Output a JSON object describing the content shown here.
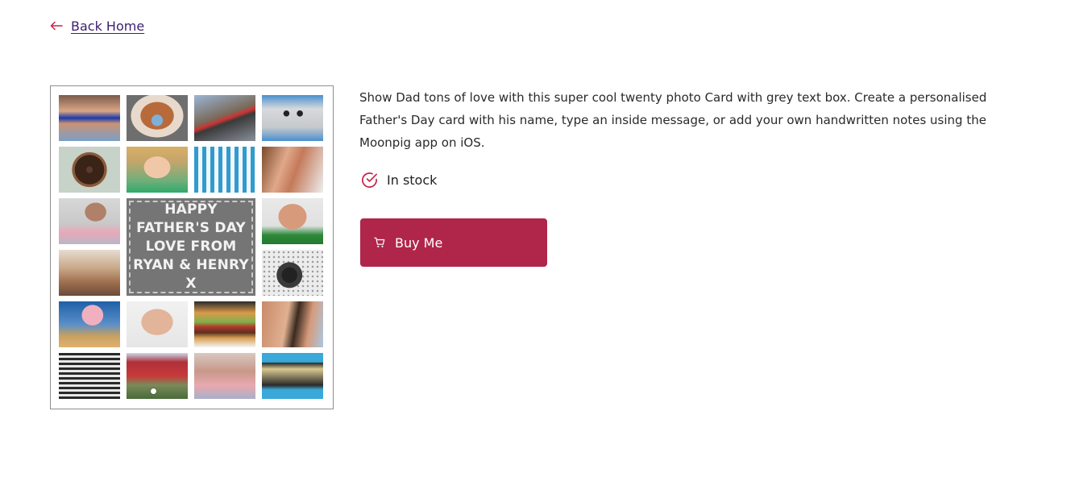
{
  "nav": {
    "back_label": "Back Home",
    "back_icon": "arrow-left-icon"
  },
  "product": {
    "card_center_text": [
      "HAPPY",
      "FATHER'S DAY",
      "LOVE FROM",
      "RYAN & HENRY X"
    ],
    "photos": [
      {
        "name": "man-sunglasses-photo",
        "icon": "photo"
      },
      {
        "name": "dog-moustache-photo",
        "icon": "photo"
      },
      {
        "name": "mountain-bike-photo",
        "icon": "photo"
      },
      {
        "name": "robot-toy-photo",
        "icon": "photo"
      },
      {
        "name": "donut-photo",
        "icon": "photo"
      },
      {
        "name": "boy-smiling-photo",
        "icon": "photo"
      },
      {
        "name": "deck-chairs-photo",
        "icon": "photo"
      },
      {
        "name": "father-child-photo",
        "icon": "photo"
      },
      {
        "name": "man-baby-photo",
        "icon": "photo"
      },
      {
        "name": "man-laughing-photo",
        "icon": "photo"
      },
      {
        "name": "family-photo",
        "icon": "photo"
      },
      {
        "name": "camera-photo",
        "icon": "photo"
      },
      {
        "name": "ice-cream-photo",
        "icon": "photo"
      },
      {
        "name": "bald-man-photo",
        "icon": "photo"
      },
      {
        "name": "burger-photo",
        "icon": "photo"
      },
      {
        "name": "couple-laughing-photo",
        "icon": "photo"
      },
      {
        "name": "father-son-photo",
        "icon": "photo"
      },
      {
        "name": "golf-flag-photo",
        "icon": "photo"
      },
      {
        "name": "grandpa-baby-photo",
        "icon": "photo"
      },
      {
        "name": "cassette-tape-photo",
        "icon": "photo"
      }
    ],
    "description": "Show Dad tons of love with this super cool twenty photo Card with grey text box. Create a personalised Father's Day card with his name, type an inside message, or add your own handwritten notes using the Moonpig app on iOS.",
    "stock_label": "In stock",
    "stock_icon": "check-circle-icon",
    "buy_label": "Buy Me",
    "buy_icon": "cart-icon"
  },
  "colors": {
    "accent": "#b0264a",
    "link": "#3d1f6e",
    "stock_icon": "#c8234a"
  }
}
